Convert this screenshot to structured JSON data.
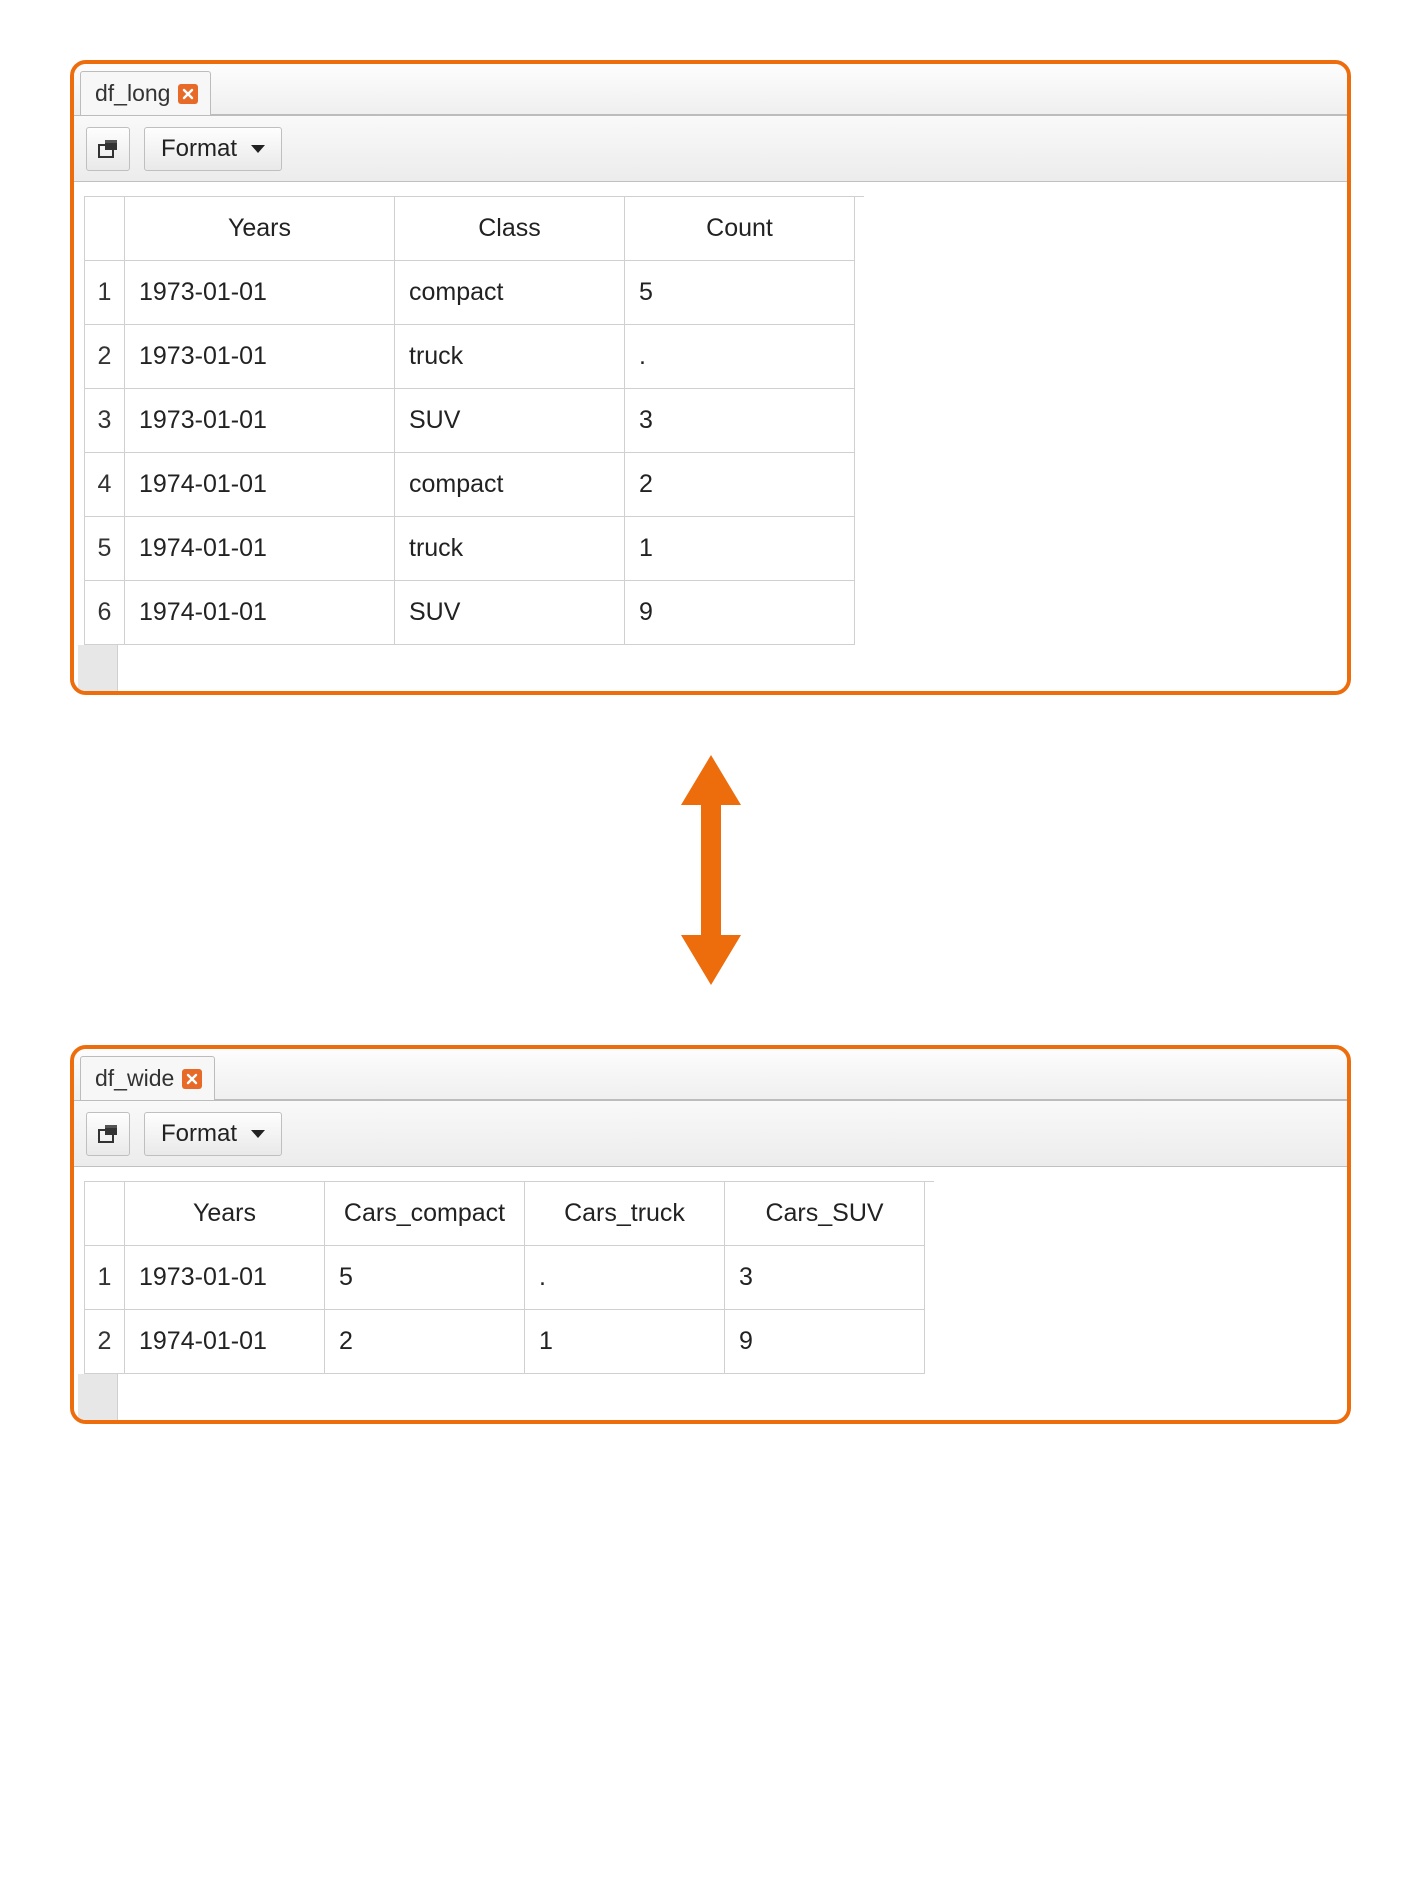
{
  "colors": {
    "accent": "#ED6C0C"
  },
  "panel_long": {
    "tab_label": "df_long",
    "format_label": "Format",
    "columns": [
      "Years",
      "Class",
      "Count"
    ],
    "rows": [
      {
        "n": "1",
        "Years": "1973-01-01",
        "Class": "compact",
        "Count": "5"
      },
      {
        "n": "2",
        "Years": "1973-01-01",
        "Class": "truck",
        "Count": "."
      },
      {
        "n": "3",
        "Years": "1973-01-01",
        "Class": "SUV",
        "Count": "3"
      },
      {
        "n": "4",
        "Years": "1974-01-01",
        "Class": "compact",
        "Count": "2"
      },
      {
        "n": "5",
        "Years": "1974-01-01",
        "Class": "truck",
        "Count": "1"
      },
      {
        "n": "6",
        "Years": "1974-01-01",
        "Class": "SUV",
        "Count": "9"
      }
    ]
  },
  "panel_wide": {
    "tab_label": "df_wide",
    "format_label": "Format",
    "columns": [
      "Years",
      "Cars_compact",
      "Cars_truck",
      "Cars_SUV"
    ],
    "rows": [
      {
        "n": "1",
        "Years": "1973-01-01",
        "Cars_compact": "5",
        "Cars_truck": ".",
        "Cars_SUV": "3"
      },
      {
        "n": "2",
        "Years": "1974-01-01",
        "Cars_compact": "2",
        "Cars_truck": "1",
        "Cars_SUV": "9"
      }
    ]
  }
}
